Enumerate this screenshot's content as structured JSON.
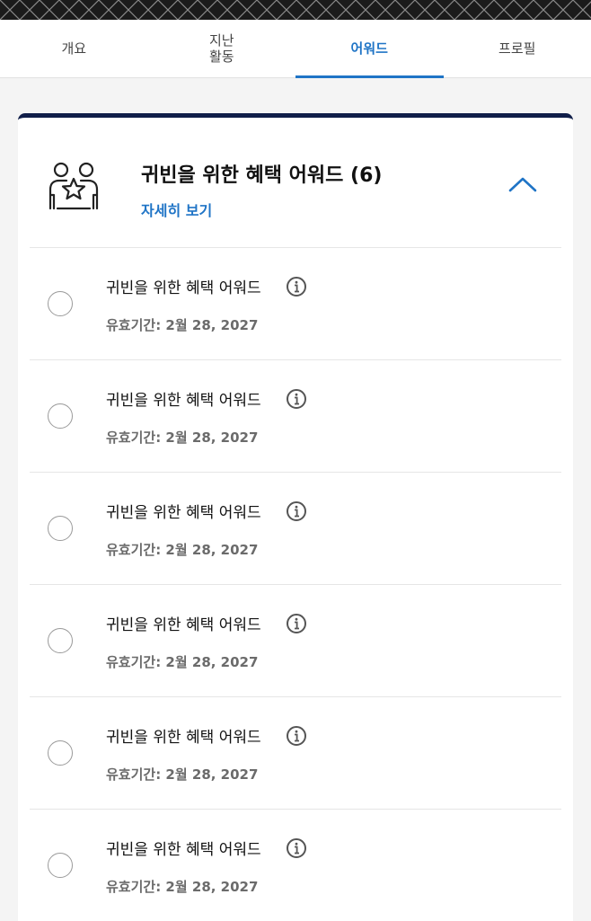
{
  "tabs": [
    {
      "label": "개요",
      "active": false
    },
    {
      "label": "지난\n활동",
      "active": false
    },
    {
      "label": "어워드",
      "active": true
    },
    {
      "label": "프로필",
      "active": false
    }
  ],
  "card": {
    "title": "귀빈을 위한 혜택 어워드 (6)",
    "details_link": "자세히 보기",
    "icon": "people-star-icon",
    "collapse_icon": "chevron-up-icon"
  },
  "awards": [
    {
      "title": "귀빈을 위한 혜택 어워드",
      "expiry": "유효기간: 2월 28, 2027"
    },
    {
      "title": "귀빈을 위한 혜택 어워드",
      "expiry": "유효기간: 2월 28, 2027"
    },
    {
      "title": "귀빈을 위한 혜택 어워드",
      "expiry": "유효기간: 2월 28, 2027"
    },
    {
      "title": "귀빈을 위한 혜택 어워드",
      "expiry": "유효기간: 2월 28, 2027"
    },
    {
      "title": "귀빈을 위한 혜택 어워드",
      "expiry": "유효기간: 2월 28, 2027"
    },
    {
      "title": "귀빈을 위한 혜택 어워드",
      "expiry": "유효기간: 2월 28, 2027"
    }
  ],
  "colors": {
    "accent": "#1f74c6",
    "card_border": "#101e49",
    "header_pattern": "#1b1b1b"
  }
}
